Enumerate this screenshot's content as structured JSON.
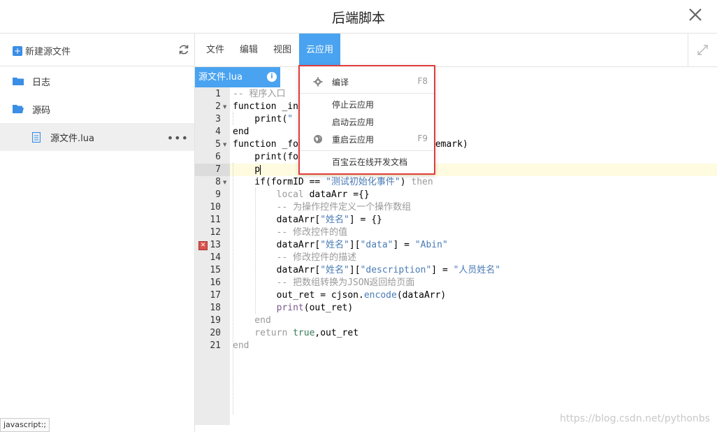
{
  "window": {
    "title": "后端脚本"
  },
  "sidebar": {
    "new_file_label": "新建源文件",
    "items": [
      {
        "label": "日志",
        "icon": "folder-icon"
      },
      {
        "label": "源码",
        "icon": "folder-open-icon"
      },
      {
        "label": "源文件.lua",
        "icon": "file-icon",
        "more": "•••"
      }
    ]
  },
  "menubar": {
    "items": [
      "文件",
      "编辑",
      "视图",
      "云应用"
    ],
    "active": "云应用"
  },
  "tab": {
    "label": "源文件.lua",
    "info": "i"
  },
  "dropdown": {
    "items": [
      {
        "label": "编译",
        "shortcut": "F8",
        "icon": "gear-icon"
      },
      {
        "label": "停止云应用",
        "shortcut": ""
      },
      {
        "label": "启动云应用",
        "shortcut": ""
      },
      {
        "label": "重启云应用",
        "shortcut": "F9",
        "icon": "globe-icon"
      },
      {
        "label": "百宝云在线开发文档",
        "shortcut": ""
      }
    ]
  },
  "editor": {
    "line_numbers": [
      "1",
      "2",
      "3",
      "4",
      "5",
      "6",
      "7",
      "8",
      "9",
      "10",
      "11",
      "12",
      "13",
      "14",
      "15",
      "16",
      "17",
      "18",
      "19",
      "20",
      "21"
    ],
    "error_line": "13",
    "lines": {
      "l1": "-- 程序入口",
      "l2a": "function ",
      "l2b": "_in",
      "l3a": "    print(",
      "l3b": "\"",
      "l4": "end",
      "l5a": "function ",
      "l5b": "_fo",
      "l5c": "remark)",
      "l6a": "    print(fo",
      "l7": "    p",
      "l8a": "    if(formID == ",
      "l8b": "\"测试初始化事件\"",
      "l8c": ") ",
      "l8d": "then",
      "l9a": "        ",
      "l9b": "local",
      "l9c": " dataArr ={}",
      "l10": "        -- 为操作控件定义一个操作数组",
      "l11a": "        dataArr[",
      "l11b": "\"姓名\"",
      "l11c": "] = {}",
      "l12": "        -- 修改控件的值",
      "l13a": "        dataArr[",
      "l13b": "\"姓名\"",
      "l13c": "][",
      "l13d": "\"data\"",
      "l13e": "] = ",
      "l13f": "\"Abin\"",
      "l14": "        -- 修改控件的描述",
      "l15a": "        dataArr[",
      "l15b": "\"姓名\"",
      "l15c": "][",
      "l15d": "\"description\"",
      "l15e": "] = ",
      "l15f": "\"人员姓名\"",
      "l16": "        -- 把数组转换为JSON返回给页面",
      "l17a": "        out_ret = cjson.",
      "l17b": "encode",
      "l17c": "(dataArr)",
      "l18a": "        print",
      "l18b": "(out_ret)",
      "l19": "    end",
      "l20a": "    return ",
      "l20b": "true",
      "l20c": ",out_ret",
      "l21": "end"
    }
  },
  "statusbar": {
    "text": "javascript:;"
  },
  "watermark": "https://blog.csdn.net/pythonbs",
  "colors": {
    "accent": "#4aa3f0",
    "highlight_border": "#e23b3b",
    "string": "#4a7bb5",
    "comment": "#9a9a9a"
  }
}
